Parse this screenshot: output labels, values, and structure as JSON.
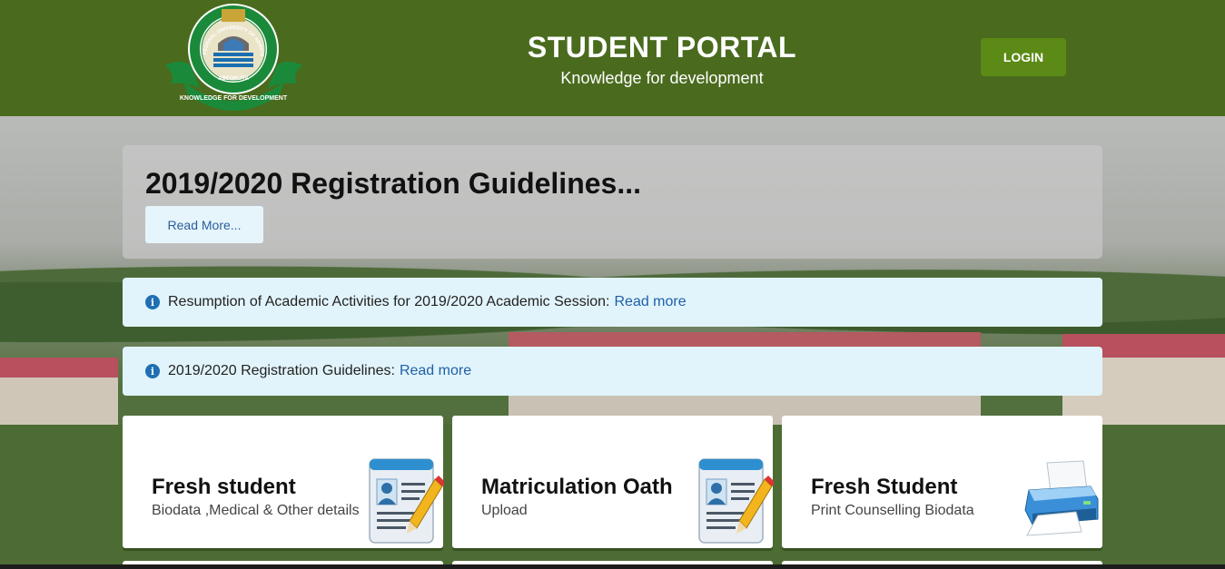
{
  "header": {
    "logo_ring_text": "FEDERAL UNIVERSITY OF AGRICULTURE",
    "logo_city": "ABEOKUTA",
    "logo_motto": "KNOWLEDGE FOR DEVELOPMENT",
    "title": "STUDENT PORTAL",
    "subtitle": "Knowledge for development",
    "login_label": "LOGIN"
  },
  "jumbotron": {
    "heading": "2019/2020 Registration Guidelines...",
    "button_label": "Read More..."
  },
  "alerts": [
    {
      "icon": "info-icon",
      "text": "Resumption of Academic Activities for 2019/2020 Academic Session:",
      "link": "Read more"
    },
    {
      "icon": "info-icon",
      "text": "2019/2020 Registration Guidelines:",
      "link": "Read more"
    }
  ],
  "cards": [
    {
      "title": "Fresh student",
      "subtitle": "Biodata ,Medical & Other details",
      "icon": "id-form-pencil-icon"
    },
    {
      "title": "Matriculation Oath",
      "subtitle": "Upload",
      "icon": "id-form-pencil-icon"
    },
    {
      "title": "Fresh Student",
      "subtitle": "Print Counselling Biodata",
      "icon": "printer-icon"
    }
  ],
  "colors": {
    "header_bg": "#4a6b1e",
    "login_button": "#5c8a16",
    "alert_bg": "#e1f4fb",
    "link": "#1f5fa8"
  }
}
